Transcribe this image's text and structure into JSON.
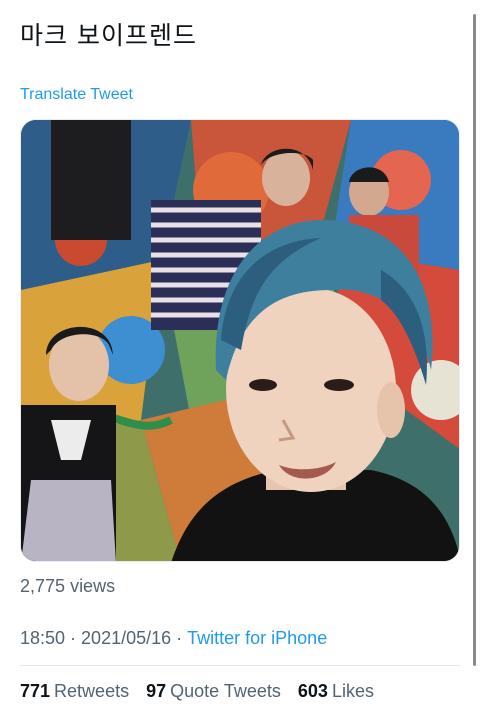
{
  "tweet": {
    "text": "마크 보이프렌드",
    "translate_label": "Translate Tweet",
    "views_count": "2,775",
    "views_label": "views",
    "time": "18:50",
    "date": "2021/05/16",
    "separator": "·",
    "source": "Twitter for iPhone"
  },
  "stats": {
    "retweets_count": "771",
    "retweets_label": "Retweets",
    "quotes_count": "97",
    "quotes_label": "Quote Tweets",
    "likes_count": "603",
    "likes_label": "Likes"
  },
  "colors": {
    "link": "#1d9bf0",
    "secondary_text": "#536471",
    "primary_text": "#0f1419"
  }
}
